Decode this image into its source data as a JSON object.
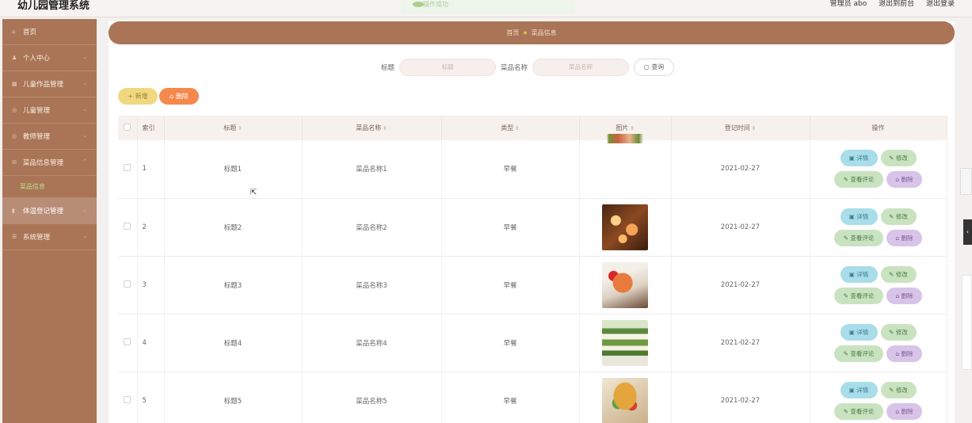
{
  "app": {
    "title": "幼儿园管理系统"
  },
  "toast": {
    "text": "操作成功"
  },
  "header": {
    "user": "管理员 abo",
    "front_link": "退出到前台",
    "logout": "退出登录"
  },
  "sidebar": {
    "items": [
      {
        "label": "首页",
        "icon": "home-icon"
      },
      {
        "label": "个人中心",
        "icon": "user-icon"
      },
      {
        "label": "儿童作品管理",
        "icon": "gallery-icon"
      },
      {
        "label": "儿童管理",
        "icon": "child-icon"
      },
      {
        "label": "教师管理",
        "icon": "teacher-icon"
      },
      {
        "label": "菜品信息管理",
        "icon": "mail-icon"
      },
      {
        "label": "体温登记管理",
        "icon": "thermometer-icon"
      },
      {
        "label": "系统管理",
        "icon": "settings-icon"
      }
    ],
    "active_sub": "菜品信息"
  },
  "breadcrumb": {
    "home": "首页",
    "current": "菜品信息"
  },
  "search": {
    "title_label": "标题",
    "title_placeholder": "标题",
    "name_label": "菜品名称",
    "name_placeholder": "菜品名称",
    "button": "查询"
  },
  "toolbar": {
    "add": "+ 新增",
    "delete": "删除"
  },
  "table": {
    "headers": [
      "索引",
      "标题",
      "菜品名称",
      "类型",
      "图片",
      "登记时间",
      "操作"
    ],
    "rows": [
      {
        "index": "1",
        "title": "标题1",
        "name": "菜品名称1",
        "type": "早餐",
        "date": "2021-02-27"
      },
      {
        "index": "2",
        "title": "标题2",
        "name": "菜品名称2",
        "type": "早餐",
        "date": "2021-02-27"
      },
      {
        "index": "3",
        "title": "标题3",
        "name": "菜品名称3",
        "type": "早餐",
        "date": "2021-02-27"
      },
      {
        "index": "4",
        "title": "标题4",
        "name": "菜品名称4",
        "type": "早餐",
        "date": "2021-02-27"
      },
      {
        "index": "5",
        "title": "标题5",
        "name": "菜品名称5",
        "type": "早餐",
        "date": "2021-02-27"
      }
    ],
    "actions": {
      "detail": "详情",
      "edit": "修改",
      "comment": "查看评论",
      "delete": "删除"
    }
  },
  "colors": {
    "brand": "#a97556",
    "add": "#f0d881",
    "delete": "#f5884c"
  }
}
